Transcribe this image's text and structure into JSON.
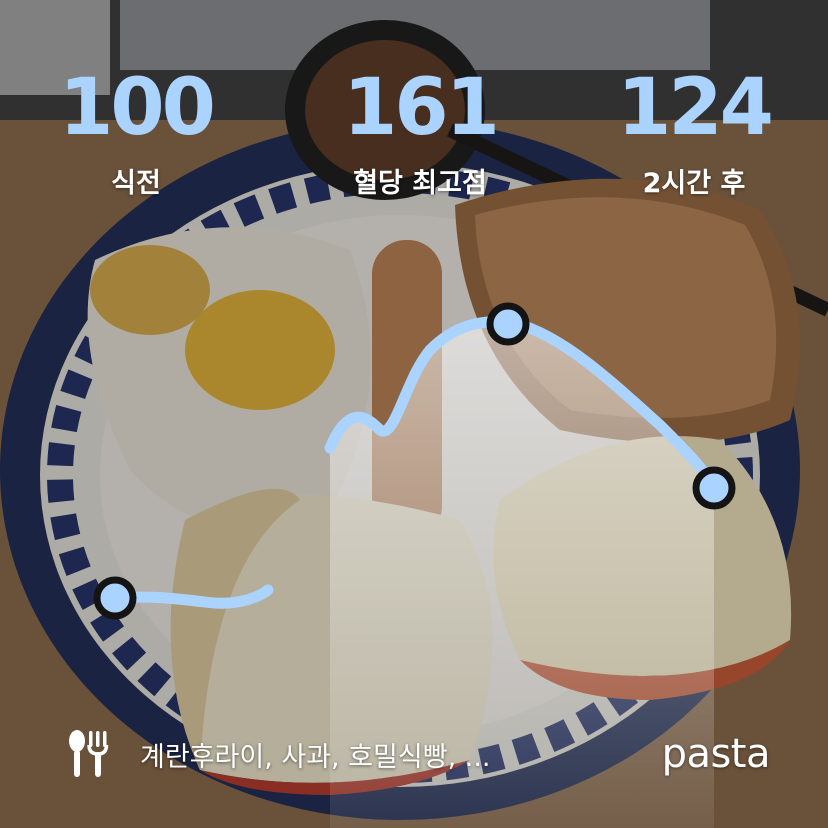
{
  "stats": [
    {
      "value": "100",
      "label": "식전"
    },
    {
      "value": "161",
      "label": "혈당 최고점"
    },
    {
      "value": "124",
      "label": "2시간 후"
    }
  ],
  "chart_data": {
    "type": "line",
    "series": [
      {
        "values_known": [
          {
            "label": "식전",
            "y": 100
          },
          {
            "label": "혈당 최고점",
            "y": 161
          },
          {
            "label": "2시간 후",
            "y": 124
          }
        ]
      }
    ],
    "highlight_markers": [
      "식전",
      "혈당 최고점",
      "2시간 후"
    ],
    "grid": false
  },
  "footer": {
    "food_icon": "fork-knife-icon",
    "foods": "계란후라이, 사과, 호밀식빵, ...",
    "brand": "pasta"
  },
  "colors": {
    "accent": "#aad3ff",
    "marker_stroke": "#141414",
    "text": "#ffffff"
  }
}
